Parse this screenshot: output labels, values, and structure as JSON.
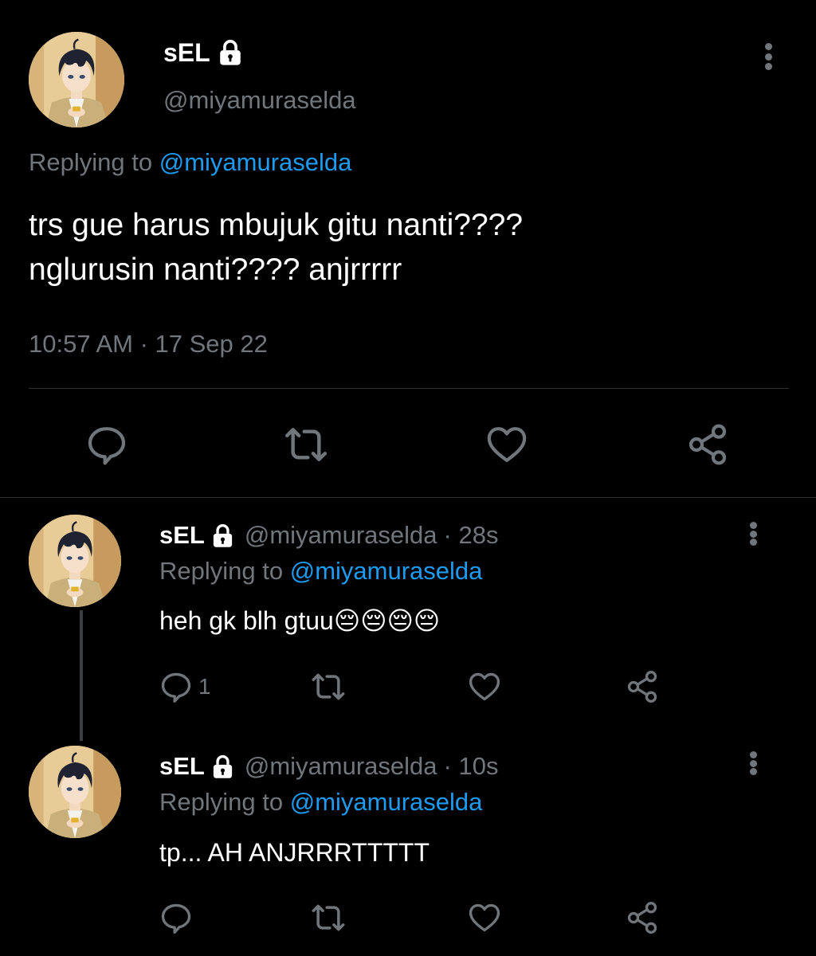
{
  "main_tweet": {
    "display_name": "sEL",
    "handle": "@miyamuraselda",
    "replying_prefix": "Replying to",
    "replying_to": "@miyamuraselda",
    "text_line1": "trs gue harus mbujuk gitu nanti????",
    "text_line2": "nglurusin nanti???? anjrrrrr",
    "timestamp": "10:57 AM · 17 Sep 22"
  },
  "replies": [
    {
      "display_name": "sEL",
      "handle": "@miyamuraselda",
      "time": "· 28s",
      "replying_prefix": "Replying to",
      "replying_to": "@miyamuraselda",
      "text": "heh gk blh gtuu😔😔😔😔",
      "reply_count": "1"
    },
    {
      "display_name": "sEL",
      "handle": "@miyamuraselda",
      "time": "· 10s",
      "replying_prefix": "Replying to",
      "replying_to": "@miyamuraselda",
      "text": "tp... AH ANJRRRTTTTT",
      "reply_count": ""
    }
  ],
  "icons": {
    "lock": "lock-icon",
    "more": "more-vertical-icon",
    "reply": "reply-icon",
    "retweet": "retweet-icon",
    "like": "heart-icon",
    "share": "share-icon"
  },
  "colors": {
    "background": "#000000",
    "text": "#ffffff",
    "muted": "#71767b",
    "link": "#1d9bf0",
    "divider": "#2f3336"
  }
}
